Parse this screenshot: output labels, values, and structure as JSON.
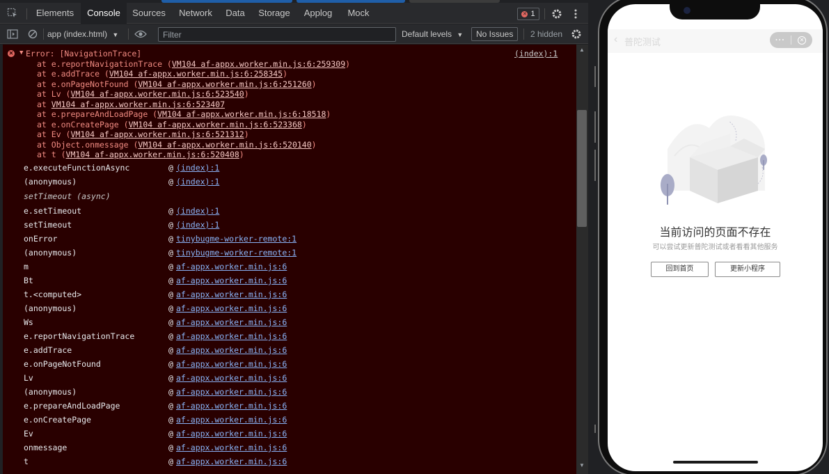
{
  "devtools": {
    "tabs": [
      {
        "label": "Elements",
        "active": false
      },
      {
        "label": "Console",
        "active": true
      },
      {
        "label": "Sources",
        "active": false
      },
      {
        "label": "Network",
        "active": false
      },
      {
        "label": "Data",
        "active": false
      },
      {
        "label": "Storage",
        "active": false
      },
      {
        "label": "Applog",
        "active": false
      },
      {
        "label": "Mock",
        "active": false
      }
    ],
    "error_count": "1",
    "toolbar": {
      "context": "app (index.html)",
      "filter_placeholder": "Filter",
      "levels": "Default levels",
      "issues": "No Issues",
      "hidden": "2 hidden"
    },
    "colors": {
      "panel_bg": "#202124",
      "console_error_bg": "#290000",
      "error_text": "#f28b82",
      "link_blue": "#8ab4f8",
      "active_tab_accent": "#1f5ea8"
    }
  },
  "console": {
    "error": {
      "message": "Error: [NavigationTrace]",
      "source": "(index):1",
      "trace": [
        {
          "at": "at e.reportNavigationTrace (",
          "loc": "VM104 af-appx.worker.min.js:6:259309",
          "end": ")"
        },
        {
          "at": "at e.addTrace (",
          "loc": "VM104 af-appx.worker.min.js:6:258345",
          "end": ")"
        },
        {
          "at": "at e.onPageNotFound (",
          "loc": "VM104 af-appx.worker.min.js:6:251260",
          "end": ")"
        },
        {
          "at": "at Lv (",
          "loc": "VM104 af-appx.worker.min.js:6:523540",
          "end": ")"
        },
        {
          "at": "at ",
          "loc": "VM104 af-appx.worker.min.js:6:523407",
          "end": ""
        },
        {
          "at": "at e.prepareAndLoadPage (",
          "loc": "VM104 af-appx.worker.min.js:6:18518",
          "end": ")"
        },
        {
          "at": "at e.onCreatePage (",
          "loc": "VM104 af-appx.worker.min.js:6:523368",
          "end": ")"
        },
        {
          "at": "at Ev (",
          "loc": "VM104 af-appx.worker.min.js:6:521312",
          "end": ")"
        },
        {
          "at": "at Object.onmessage (",
          "loc": "VM104 af-appx.worker.min.js:6:520140",
          "end": ")"
        },
        {
          "at": "at t (",
          "loc": "VM104 af-appx.worker.min.js:6:520408",
          "end": ")"
        }
      ]
    },
    "stack": [
      {
        "fn": "e.executeFunctionAsync",
        "link": "(index):1"
      },
      {
        "fn": "(anonymous)",
        "link": "(index):1"
      },
      {
        "fn": "setTimeout (async)",
        "async": true
      },
      {
        "fn": "e.setTimeout",
        "link": "(index):1"
      },
      {
        "fn": "setTimeout",
        "link": "(index):1"
      },
      {
        "fn": "onError",
        "link": "tinybugme-worker-remote:1"
      },
      {
        "fn": "(anonymous)",
        "link": "tinybugme-worker-remote:1"
      },
      {
        "fn": "m",
        "link": "af-appx.worker.min.js:6"
      },
      {
        "fn": "Bt",
        "link": "af-appx.worker.min.js:6"
      },
      {
        "fn": "t.<computed>",
        "link": "af-appx.worker.min.js:6"
      },
      {
        "fn": "(anonymous)",
        "link": "af-appx.worker.min.js:6"
      },
      {
        "fn": "Ws",
        "link": "af-appx.worker.min.js:6"
      },
      {
        "fn": "e.reportNavigationTrace",
        "link": "af-appx.worker.min.js:6"
      },
      {
        "fn": "e.addTrace",
        "link": "af-appx.worker.min.js:6"
      },
      {
        "fn": "e.onPageNotFound",
        "link": "af-appx.worker.min.js:6"
      },
      {
        "fn": "Lv",
        "link": "af-appx.worker.min.js:6"
      },
      {
        "fn": "(anonymous)",
        "link": "af-appx.worker.min.js:6"
      },
      {
        "fn": "e.prepareAndLoadPage",
        "link": "af-appx.worker.min.js:6"
      },
      {
        "fn": "e.onCreatePage",
        "link": "af-appx.worker.min.js:6"
      },
      {
        "fn": "Ev",
        "link": "af-appx.worker.min.js:6"
      },
      {
        "fn": "onmessage",
        "link": "af-appx.worker.min.js:6"
      },
      {
        "fn": "t",
        "link": "af-appx.worker.min.js:6"
      }
    ]
  },
  "simulator": {
    "nav_title": "普陀测试",
    "empty_title": "当前访问的页面不存在",
    "empty_subtitle": "可以尝试更新普陀测试或者看看其他服务",
    "btn_home": "回到首页",
    "btn_update": "更新小程序",
    "colors": {
      "screen_bg": "#ffffff",
      "navbar_bg": "#f7f7f7",
      "title_text": "#333333"
    }
  }
}
